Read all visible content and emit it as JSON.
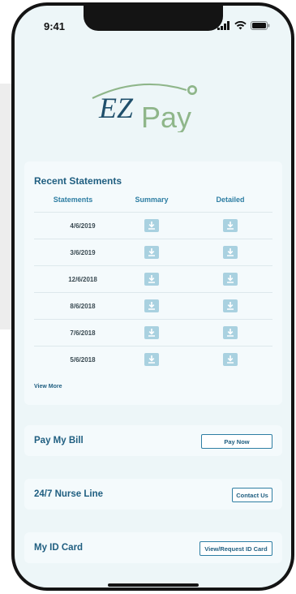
{
  "status_bar": {
    "time": "9:41"
  },
  "logo": {
    "text_ez": "EZ",
    "text_pay": "Pay"
  },
  "statements": {
    "title": "Recent Statements",
    "columns": [
      "Statements",
      "Summary",
      "Detailed"
    ],
    "rows": [
      "4/6/2019",
      "3/6/2019",
      "12/6/2018",
      "8/6/2018",
      "7/6/2018",
      "5/6/2018"
    ],
    "view_more": "View More"
  },
  "pay_bill": {
    "title": "Pay My Bill",
    "button": "Pay Now"
  },
  "nurse_line": {
    "title": "24/7 Nurse Line",
    "button": "Contact Us"
  },
  "id_card": {
    "title": "My ID Card",
    "button": "View/Request ID Card"
  },
  "colors": {
    "accent_blue": "#1f5e80",
    "accent_green": "#8fb68a",
    "download_icon_bg": "#a9d1e0",
    "screen_bg": "#edf6f8"
  },
  "icons": [
    "signal-icon",
    "wifi-icon",
    "battery-icon",
    "download-icon"
  ]
}
